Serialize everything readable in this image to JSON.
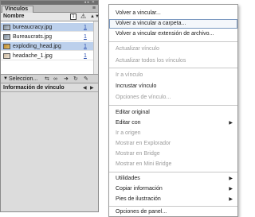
{
  "panel": {
    "tab_label": "Vínculos",
    "column_header": "Nombre",
    "header_icons": {
      "page_icon": "page-icon",
      "alert_icon": "warning-icon",
      "sort_icon": "sort-icon"
    },
    "menu_button_icon": "panel-menu-icon",
    "files": [
      {
        "name": "bureaucracy.jpg",
        "page": "1",
        "selected": true
      },
      {
        "name": "Bureaucrats.jpg",
        "page": "1",
        "selected": false
      },
      {
        "name": "exploding_head.jpg",
        "page": "1",
        "selected": true
      },
      {
        "name": "headache_1.jpg",
        "page": "1",
        "selected": false
      }
    ],
    "toolbar": {
      "selection_label": "Seleccion...",
      "icons": [
        "relink-cc-icon",
        "chain-link-icon",
        "go-to-link-icon",
        "update-link-icon",
        "edit-original-icon"
      ]
    },
    "info": {
      "title": "Información de vínculo",
      "nav_icons": [
        "previous-icon",
        "next-icon"
      ]
    }
  },
  "menu": {
    "items": [
      {
        "label": "Volver a vincular...",
        "enabled": true,
        "submenu": false
      },
      {
        "label": "Volver a vincular a carpeta...",
        "enabled": true,
        "submenu": false,
        "highlight": true
      },
      {
        "label": "Volver a vincular extensión de archivo...",
        "enabled": true,
        "submenu": false
      },
      {
        "separator": true
      },
      {
        "label": "Actualizar vínculo",
        "enabled": false,
        "submenu": false
      },
      {
        "label": "Actualizar todos los vínculos",
        "enabled": false,
        "submenu": false
      },
      {
        "separator": true
      },
      {
        "label": "Ir a vínculo",
        "enabled": false,
        "submenu": false
      },
      {
        "label": "Incrustar vínculo",
        "enabled": true,
        "submenu": false
      },
      {
        "label": "Opciones de vínculo...",
        "enabled": false,
        "submenu": false
      },
      {
        "separator": true
      },
      {
        "label": "Editar original",
        "enabled": true,
        "submenu": false
      },
      {
        "label": "Editar con",
        "enabled": true,
        "submenu": true
      },
      {
        "label": "Ir a origen",
        "enabled": false,
        "submenu": false
      },
      {
        "label": "Mostrar en Explorador",
        "enabled": false,
        "submenu": false
      },
      {
        "label": "Mostrar en Bridge",
        "enabled": false,
        "submenu": false
      },
      {
        "label": "Mostrar en Mini Bridge",
        "enabled": false,
        "submenu": false
      },
      {
        "separator": true
      },
      {
        "label": "Utilidades",
        "enabled": true,
        "submenu": true
      },
      {
        "label": "Copiar información",
        "enabled": true,
        "submenu": true
      },
      {
        "label": "Pies de ilustración",
        "enabled": true,
        "submenu": true
      },
      {
        "separator": true
      },
      {
        "label": "Opciones de panel...",
        "enabled": true,
        "submenu": false
      }
    ]
  }
}
